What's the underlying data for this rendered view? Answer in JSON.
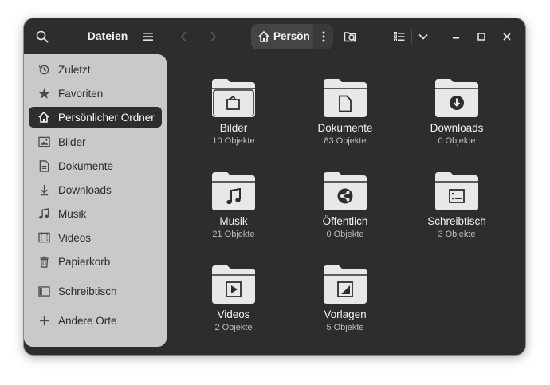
{
  "header": {
    "title": "Dateien",
    "path_current": "Persön"
  },
  "sidebar": {
    "items": [
      {
        "label": "Zuletzt",
        "icon": "clock-icon"
      },
      {
        "label": "Favoriten",
        "icon": "star-icon"
      },
      {
        "label": "Persönlicher Ordner",
        "icon": "home-icon",
        "active": true
      },
      {
        "label": "Bilder",
        "icon": "image-icon"
      },
      {
        "label": "Dokumente",
        "icon": "document-icon"
      },
      {
        "label": "Downloads",
        "icon": "download-icon"
      },
      {
        "label": "Musik",
        "icon": "music-icon"
      },
      {
        "label": "Videos",
        "icon": "video-icon"
      },
      {
        "label": "Papierkorb",
        "icon": "trash-icon"
      },
      {
        "label": "Schreibtisch",
        "icon": "desktop-icon"
      },
      {
        "label": "Andere Orte",
        "icon": "plus-icon"
      }
    ]
  },
  "folders": [
    {
      "name": "Bilder",
      "count": "10 Objekte",
      "icon": "image-icon"
    },
    {
      "name": "Dokumente",
      "count": "83 Objekte",
      "icon": "document-icon"
    },
    {
      "name": "Downloads",
      "count": "0 Objekte",
      "icon": "download-icon"
    },
    {
      "name": "Musik",
      "count": "21 Objekte",
      "icon": "music-icon"
    },
    {
      "name": "Öffentlich",
      "count": "0 Objekte",
      "icon": "share-icon"
    },
    {
      "name": "Schreibtisch",
      "count": "3 Objekte",
      "icon": "desktop-icon"
    },
    {
      "name": "Videos",
      "count": "2 Objekte",
      "icon": "play-icon"
    },
    {
      "name": "Vorlagen",
      "count": "5 Objekte",
      "icon": "template-icon"
    }
  ],
  "colors": {
    "window_bg": "#2d2d2d",
    "sidebar_bg": "#c9c9c9",
    "sidebar_active_bg": "#2e2e2e",
    "folder_fill": "#e8e8e8"
  }
}
